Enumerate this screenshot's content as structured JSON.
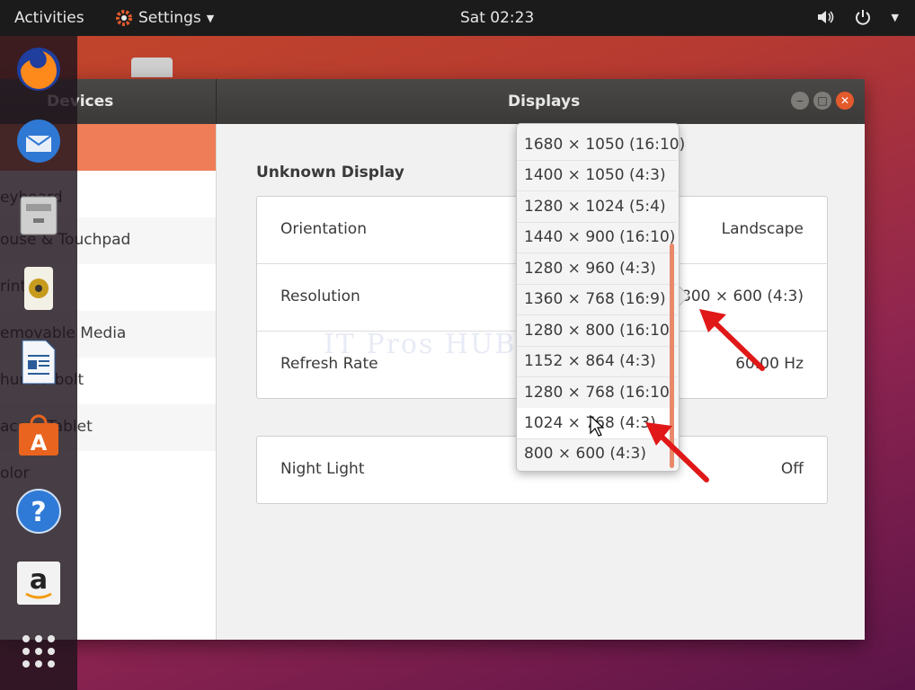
{
  "topbar": {
    "activities": "Activities",
    "app_menu": "Settings",
    "clock": "Sat 02:23"
  },
  "dock": {
    "items": [
      {
        "icon": "firefox-icon"
      },
      {
        "icon": "thunderbird-icon"
      },
      {
        "icon": "files-icon"
      },
      {
        "icon": "rhythmbox-icon"
      },
      {
        "icon": "writer-icon"
      },
      {
        "icon": "software-icon"
      },
      {
        "icon": "help-icon"
      },
      {
        "icon": "amazon-icon"
      },
      {
        "icon": "show-apps-icon"
      }
    ]
  },
  "window": {
    "sidebar_title": "Devices",
    "title": "Displays"
  },
  "sidebar": {
    "items": [
      {
        "label": ""
      },
      {
        "label": ""
      },
      {
        "label": "ouse & Touchpad"
      },
      {
        "label": "rint"
      },
      {
        "label": "emovable Media"
      },
      {
        "label": "hunderbolt"
      },
      {
        "label": "acom Tablet"
      },
      {
        "label": "olor"
      }
    ],
    "partial_labels": [
      "eyboard"
    ]
  },
  "display": {
    "section_title": "Unknown Display",
    "orientation_label": "Orientation",
    "orientation_value": "Landscape",
    "resolution_label": "Resolution",
    "resolution_value": "800 × 600 (4:3)",
    "refresh_label": "Refresh Rate",
    "refresh_value": "60.00 Hz",
    "night_light_label": "Night Light",
    "night_light_value": "Off"
  },
  "resolution_options": [
    "1680 × 1050 (16:10)",
    "1400 × 1050 (4:3)",
    "1280 × 1024 (5:4)",
    "1440 × 900 (16:10)",
    "1280 × 960 (4:3)",
    "1360 × 768 (16:9)",
    "1280 × 800 (16:10)",
    "1152 × 864 (4:3)",
    "1280 × 768 (16:10)",
    "1024 × 768 (4:3)",
    "800 × 600 (4:3)"
  ],
  "watermark": "IT Pros HUB",
  "colors": {
    "accent": "#ef7d57",
    "close_button": "#e45a2c",
    "annotation_arrow": "#e01818"
  }
}
